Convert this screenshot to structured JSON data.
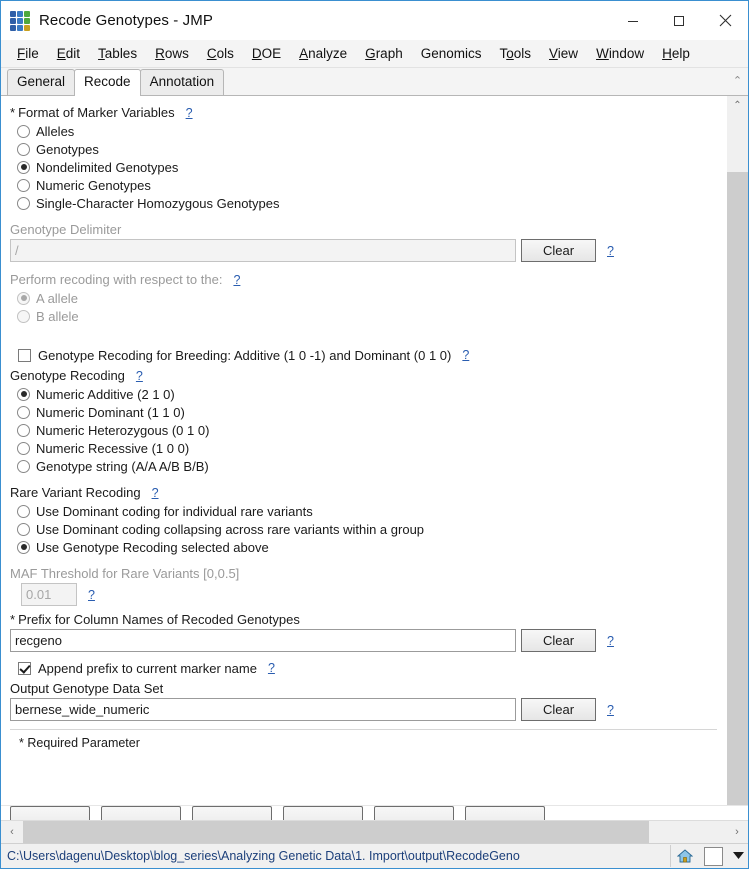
{
  "window": {
    "title": "Recode Genotypes - JMP",
    "app_icon": "genotype-grid-icon",
    "minimize_label": "—",
    "maximize_label": "□",
    "close_label": "✕"
  },
  "menubar": {
    "items": [
      {
        "label": "File",
        "mnemonic": "F"
      },
      {
        "label": "Edit",
        "mnemonic": "E"
      },
      {
        "label": "Tables",
        "mnemonic": "T"
      },
      {
        "label": "Rows",
        "mnemonic": "R"
      },
      {
        "label": "Cols",
        "mnemonic": "C"
      },
      {
        "label": "DOE",
        "mnemonic": "D"
      },
      {
        "label": "Analyze",
        "mnemonic": "A"
      },
      {
        "label": "Graph",
        "mnemonic": "G"
      },
      {
        "label": "Genomics",
        "mnemonic": ""
      },
      {
        "label": "Tools",
        "mnemonic": "o"
      },
      {
        "label": "View",
        "mnemonic": "V"
      },
      {
        "label": "Window",
        "mnemonic": "W"
      },
      {
        "label": "Help",
        "mnemonic": "H"
      }
    ]
  },
  "tabs": {
    "items": [
      {
        "label": "General",
        "active": false
      },
      {
        "label": "Recode",
        "active": true
      },
      {
        "label": "Annotation",
        "active": false
      }
    ]
  },
  "form": {
    "format_section": {
      "required_marker": "*",
      "label": "Format of Marker Variables",
      "help": "?",
      "options": [
        {
          "label": "Alleles",
          "selected": false
        },
        {
          "label": "Genotypes",
          "selected": false
        },
        {
          "label": "Nondelimited Genotypes",
          "selected": true
        },
        {
          "label": "Numeric Genotypes",
          "selected": false
        },
        {
          "label": "Single-Character Homozygous Genotypes",
          "selected": false
        }
      ]
    },
    "delimiter_section": {
      "label": "Genotype Delimiter",
      "disabled": true,
      "value": "/",
      "clear_label": "Clear",
      "help": "?"
    },
    "respect_section": {
      "label": "Perform recoding with respect to the:",
      "help": "?",
      "disabled": true,
      "options": [
        {
          "label": "A allele",
          "selected": true
        },
        {
          "label": "B allele",
          "selected": false
        }
      ]
    },
    "breeding_checkbox": {
      "label": "Genotype Recoding for Breeding: Additive (1 0 -1) and Dominant (0 1 0)",
      "checked": false,
      "help": "?"
    },
    "genotype_recoding": {
      "label": "Genotype Recoding",
      "help": "?",
      "options": [
        {
          "label": "Numeric Additive (2 1 0)",
          "selected": true
        },
        {
          "label": "Numeric Dominant (1 1 0)",
          "selected": false
        },
        {
          "label": "Numeric Heterozygous (0 1 0)",
          "selected": false
        },
        {
          "label": "Numeric Recessive (1 0 0)",
          "selected": false
        },
        {
          "label": "Genotype string (A/A A/B B/B)",
          "selected": false
        }
      ]
    },
    "rare_variant_recoding": {
      "label": "Rare Variant Recoding",
      "help": "?",
      "options": [
        {
          "label": "Use Dominant coding for individual rare variants",
          "selected": false
        },
        {
          "label": "Use Dominant coding collapsing across rare variants within a group",
          "selected": false
        },
        {
          "label": "Use Genotype Recoding selected above",
          "selected": true
        }
      ]
    },
    "maf_section": {
      "label": "MAF Threshold for Rare Variants [0,0.5]",
      "value": "0.01",
      "disabled": true,
      "help": "?"
    },
    "prefix_section": {
      "required_marker": "*",
      "label": "Prefix for Column Names of Recoded Genotypes",
      "value": "recgeno",
      "clear_label": "Clear",
      "help": "?"
    },
    "append_checkbox": {
      "label": "Append prefix to current marker name",
      "checked": true,
      "help": "?"
    },
    "output_section": {
      "label": "Output Genotype Data Set",
      "value": "bernese_wide_numeric",
      "clear_label": "Clear",
      "help": "?"
    },
    "footnote": "* Required Parameter"
  },
  "scrollbars": {
    "vertical_up": "⌃",
    "horizontal_left": "‹",
    "horizontal_right": "›",
    "tab_scroll_up": "⌃"
  },
  "statusbar": {
    "path": "C:\\Users\\dagenu\\Desktop\\blog_series\\Analyzing Genetic Data\\1. Import\\output\\RecodeGeno",
    "home_icon": "home-icon",
    "caret_icon": "caret-down-icon"
  }
}
